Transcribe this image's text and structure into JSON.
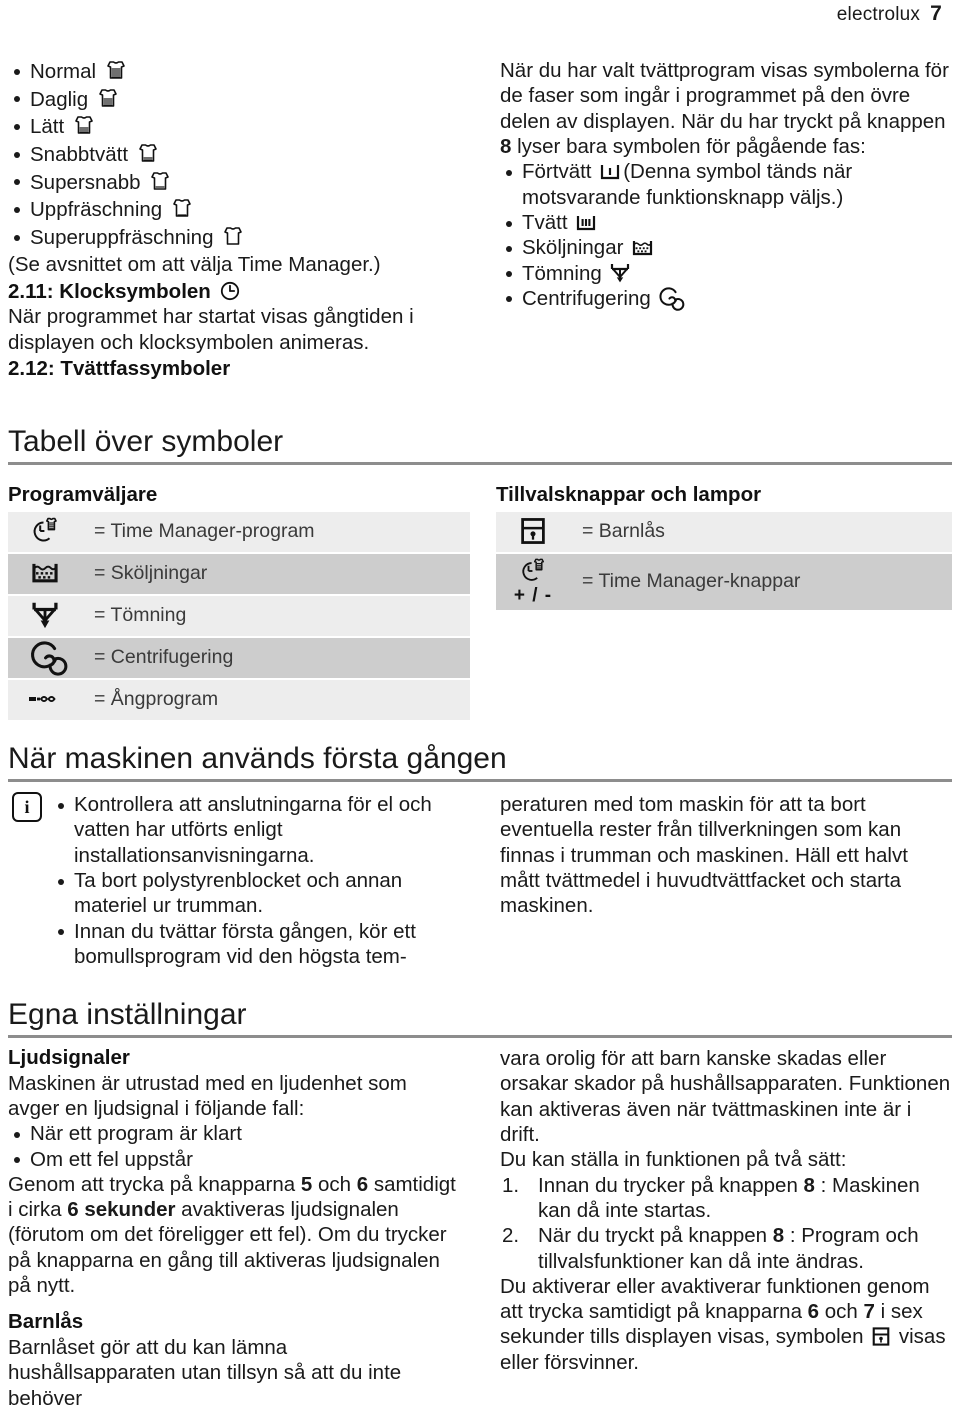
{
  "header": {
    "brand": "electrolux",
    "page_number": "7"
  },
  "left_top": {
    "program_list": [
      {
        "label": "Normal",
        "icon": "tshirt-full-icon",
        "fill": 5
      },
      {
        "label": "Daglig",
        "icon": "tshirt-4-icon",
        "fill": 4
      },
      {
        "label": "Lätt",
        "icon": "tshirt-3-icon",
        "fill": 3
      },
      {
        "label": "Snabbtvätt",
        "icon": "tshirt-2-icon",
        "fill": 2
      },
      {
        "label": "Supersnabb",
        "icon": "tshirt-1-icon",
        "fill": 1
      },
      {
        "label": "Uppfräschning",
        "icon": "tshirt-half-icon",
        "fill": 1
      },
      {
        "label": "Superuppfräschning",
        "icon": "tshirt-empty-icon",
        "fill": 0
      }
    ],
    "note": "(Se avsnittet om att välja Time Manager.)",
    "clock_heading": "2.11: Klocksymbolen",
    "clock_body": "När programmet har startat visas gångtiden i displayen och klocksymbolen animeras.",
    "drum_heading": "2.12: Tvättfassymboler"
  },
  "right_top": {
    "intro_1": "När du har valt tvättprogram visas symbolerna för de faser som ingår i programmet på den övre delen av displayen. När du har tryckt på knappen ",
    "intro_bold": "8",
    "intro_2": " lyser bara symbolen för pågående fas:",
    "phases": [
      {
        "label": "Förtvätt",
        "icon": "prewash-icon",
        "suffix": "(Denna symbol tänds när motsvarande funktionsknapp väljs.)"
      },
      {
        "label": "Tvätt",
        "icon": "wash-icon",
        "suffix": ""
      },
      {
        "label": "Sköljningar",
        "icon": "rinse-icon",
        "suffix": ""
      },
      {
        "label": "Tömning",
        "icon": "drain-icon",
        "suffix": ""
      },
      {
        "label": "Centrifugering",
        "icon": "spin-icon",
        "suffix": ""
      }
    ]
  },
  "symbol_table": {
    "title": "Tabell över symboler",
    "left": {
      "heading": "Programväljare",
      "rows": [
        {
          "icon": "time-manager-icon",
          "label": "= Time Manager-program"
        },
        {
          "icon": "rinse-icon",
          "label": "= Sköljningar"
        },
        {
          "icon": "drain-icon",
          "label": "= Tömning"
        },
        {
          "icon": "spin-icon",
          "label": "= Centrifugering"
        },
        {
          "icon": "steam-icon",
          "label": "= Ångprogram"
        }
      ]
    },
    "right": {
      "heading": "Tillvalsknappar och lampor",
      "rows": [
        {
          "icon": "child-lock-icon",
          "label": "= Barnlås",
          "sublabel": ""
        },
        {
          "icon": "time-manager-icon",
          "label": "= Time Manager-knappar",
          "sublabel": "+ / -"
        }
      ]
    }
  },
  "first_use": {
    "title": "När maskinen används första gången",
    "info_icon": "info-icon",
    "bullets": [
      "Kontrollera att anslutningarna för el och vatten har utförts enligt installationsanvisningarna.",
      "Ta bort polystyrenblocket och annan materiel ur trumman.",
      "Innan du tvättar första gången, kör ett bomullsprogram vid den högsta tem-"
    ],
    "right_continuation": "peraturen med tom maskin för att ta bort eventuella rester från tillverkningen som kan finnas i trumman och maskinen. Häll ett halvt mått tvättmedel i huvudtvättfacket och starta maskinen."
  },
  "own_settings": {
    "title": "Egna inställningar",
    "sound_heading": "Ljudsignaler",
    "sound_intro": "Maskinen är utrustad med en ljudenhet som avger en ljudsignal i följande fall:",
    "sound_bullets": [
      "När ett program är klart",
      "Om ett fel uppstår"
    ],
    "sound_body_1": "Genom att trycka på knapparna ",
    "sound_b1": "5",
    "sound_body_2": " och ",
    "sound_b2": "6",
    "sound_body_3": " samtidigt i cirka ",
    "sound_b3": "6 sekunder",
    "sound_body_4": " avaktiveras ljudsignalen (förutom om det föreligger ett fel). Om du trycker på knapparna en gång till aktiveras ljudsignalen på nytt.",
    "lock_heading": "Barnlås",
    "lock_body_left": "Barnlåset gör att du kan lämna hushållsapparaten utan tillsyn så att du inte behöver",
    "lock_body_right_1": "vara orolig för att barn kanske skadas eller orsakar skador på hushållsapparaten. Funktionen kan aktiveras även när tvättmaskinen inte är i drift.",
    "lock_body_right_2": "Du kan ställa in funktionen på två sätt:",
    "lock_steps": [
      {
        "n": "1.",
        "t1": "Innan du trycker på knappen ",
        "b": "8",
        "t2": " : Maskinen kan då inte startas."
      },
      {
        "n": "2.",
        "t1": "När du tryckt på knappen ",
        "b": "8",
        "t2": " : Program och tillvalsfunktioner kan då inte ändras."
      }
    ],
    "lock_tail_1": "Du aktiverar eller avaktiverar funktionen genom att trycka samtidigt på knapparna ",
    "lock_tb1": "6",
    "lock_tail_2": " och ",
    "lock_tb2": "7",
    "lock_tail_3": " i sex sekunder tills displayen visas, symbolen ",
    "lock_tail_4": " visas eller försvinner.",
    "lock_icon": "child-lock-icon"
  }
}
